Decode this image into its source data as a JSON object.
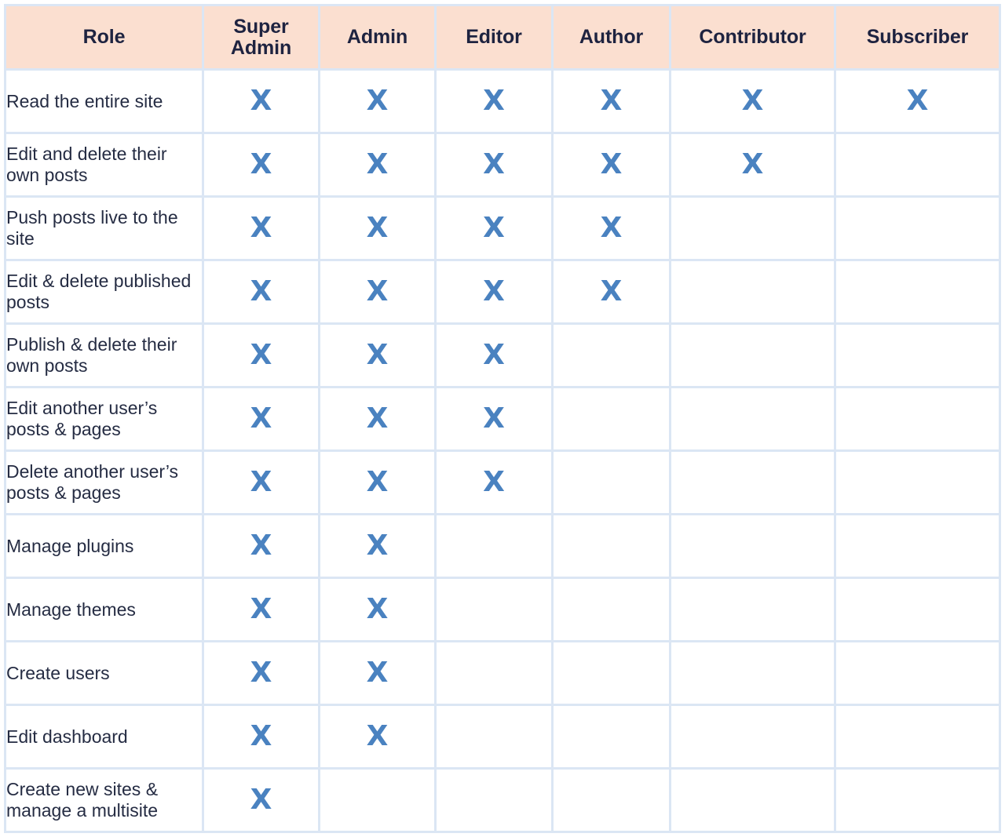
{
  "table": {
    "columns": [
      {
        "key": "role",
        "label": "Role"
      },
      {
        "key": "superadmin",
        "label": "Super Admin"
      },
      {
        "key": "admin",
        "label": "Admin"
      },
      {
        "key": "editor",
        "label": "Editor"
      },
      {
        "key": "author",
        "label": "Author"
      },
      {
        "key": "contributor",
        "label": "Contributor"
      },
      {
        "key": "subscriber",
        "label": "Subscriber"
      }
    ],
    "mark_symbol": "X",
    "colors": {
      "header_background": "#fbdfd0",
      "header_text": "#1e2340",
      "grid_border": "#dbe6f4",
      "mark": "#4a82c0",
      "body_text": "#252c43",
      "cell_background": "#ffffff"
    },
    "rows": [
      {
        "label": "Read the entire site",
        "marks": {
          "superadmin": "X",
          "admin": "X",
          "editor": "X",
          "author": "X",
          "contributor": "X",
          "subscriber": "X"
        }
      },
      {
        "label": "Edit and delete their own posts",
        "marks": {
          "superadmin": "X",
          "admin": "X",
          "editor": "X",
          "author": "X",
          "contributor": "X",
          "subscriber": ""
        }
      },
      {
        "label": "Push posts live to the site",
        "marks": {
          "superadmin": "X",
          "admin": "X",
          "editor": "X",
          "author": "X",
          "contributor": "",
          "subscriber": ""
        }
      },
      {
        "label": "Edit & delete published posts",
        "marks": {
          "superadmin": "X",
          "admin": "X",
          "editor": "X",
          "author": "X",
          "contributor": "",
          "subscriber": ""
        }
      },
      {
        "label": "Publish & delete their own posts",
        "marks": {
          "superadmin": "X",
          "admin": "X",
          "editor": "X",
          "author": "",
          "contributor": "",
          "subscriber": ""
        }
      },
      {
        "label": "Edit another user’s posts & pages",
        "marks": {
          "superadmin": "X",
          "admin": "X",
          "editor": "X",
          "author": "",
          "contributor": "",
          "subscriber": ""
        }
      },
      {
        "label": "Delete another user’s posts & pages",
        "marks": {
          "superadmin": "X",
          "admin": "X",
          "editor": "X",
          "author": "",
          "contributor": "",
          "subscriber": ""
        }
      },
      {
        "label": "Manage plugins",
        "marks": {
          "superadmin": "X",
          "admin": "X",
          "editor": "",
          "author": "",
          "contributor": "",
          "subscriber": ""
        }
      },
      {
        "label": "Manage themes",
        "marks": {
          "superadmin": "X",
          "admin": "X",
          "editor": "",
          "author": "",
          "contributor": "",
          "subscriber": ""
        }
      },
      {
        "label": "Create users",
        "marks": {
          "superadmin": "X",
          "admin": "X",
          "editor": "",
          "author": "",
          "contributor": "",
          "subscriber": ""
        }
      },
      {
        "label": "Edit dashboard",
        "marks": {
          "superadmin": "X",
          "admin": "X",
          "editor": "",
          "author": "",
          "contributor": "",
          "subscriber": ""
        }
      },
      {
        "label": "Create new sites & manage a multisite",
        "marks": {
          "superadmin": "X",
          "admin": "",
          "editor": "",
          "author": "",
          "contributor": "",
          "subscriber": ""
        }
      }
    ]
  }
}
